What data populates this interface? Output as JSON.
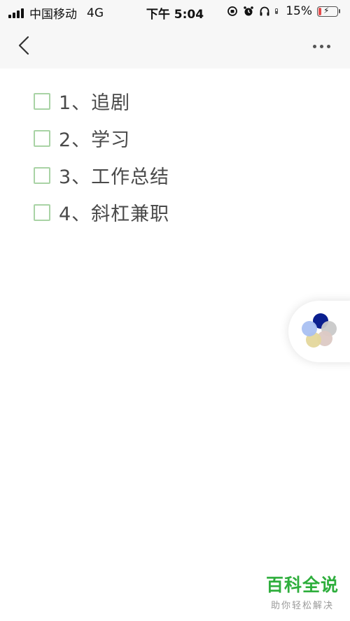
{
  "status_bar": {
    "carrier": "中国移动",
    "network": "4G",
    "time": "下午 5:04",
    "battery_percent": "15%",
    "battery_level": 0.15,
    "icons": [
      "signal-icon",
      "orientation-lock-icon",
      "alarm-icon",
      "headphones-icon",
      "battery-icon"
    ]
  },
  "nav": {
    "back_icon": "chevron-left-icon",
    "more_icon": "more-dots-icon"
  },
  "checklist": {
    "items": [
      {
        "label": "1、追剧",
        "checked": false
      },
      {
        "label": "2、学习",
        "checked": false
      },
      {
        "label": "3、工作总结",
        "checked": false
      },
      {
        "label": "4、斜杠兼职",
        "checked": false
      }
    ]
  },
  "floating_widget": {
    "icon": "pinwheel-icon"
  },
  "watermark": {
    "title": "百科全说",
    "subtitle": "助你轻松解决"
  },
  "colors": {
    "checkbox_border": "#a9d3a5",
    "watermark_green": "#2eae3c",
    "battery_low": "#e54b4b"
  }
}
